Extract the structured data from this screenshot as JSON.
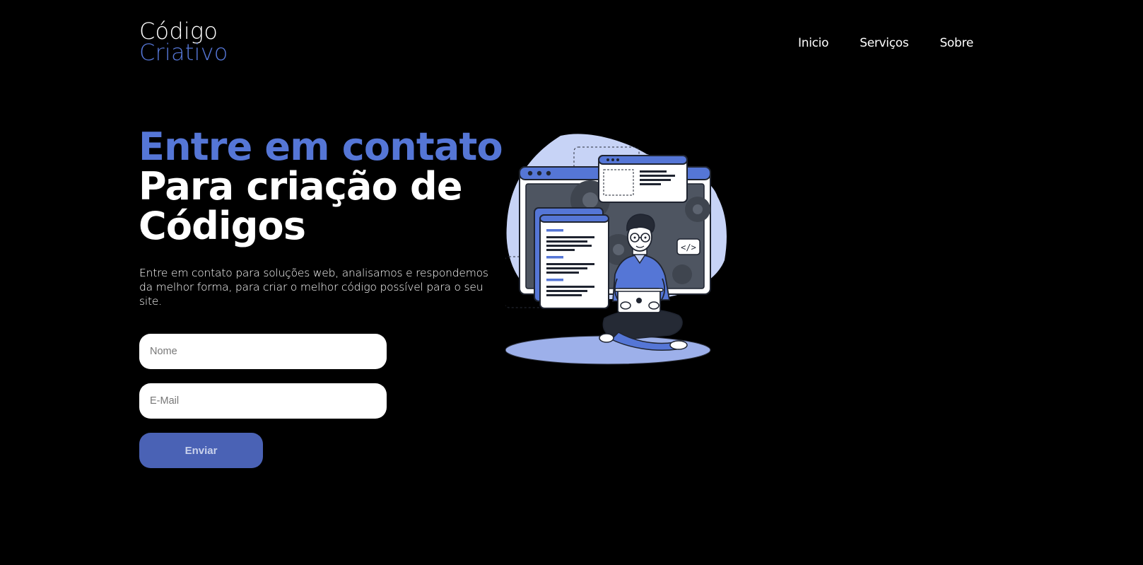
{
  "header": {
    "logo_line1": "Código",
    "logo_line2": "Criativo",
    "nav": [
      "Inicio",
      "Serviços",
      "Sobre"
    ]
  },
  "hero": {
    "title_line1": "Entre em contato",
    "title_line2": "Para criação de",
    "title_line3": "Códigos",
    "description": "Entre em contato para soluções web, analisamos e respondemos da melhor forma, para criar o melhor código possível para o seu site."
  },
  "form": {
    "name_placeholder": "Nome",
    "email_placeholder": "E-Mail",
    "submit_label": "Enviar"
  },
  "illustration": {
    "code_tag": "</>"
  },
  "colors": {
    "background": "#000000",
    "accent": "#5576d6",
    "button": "#4a62b5",
    "text": "#ffffff"
  }
}
